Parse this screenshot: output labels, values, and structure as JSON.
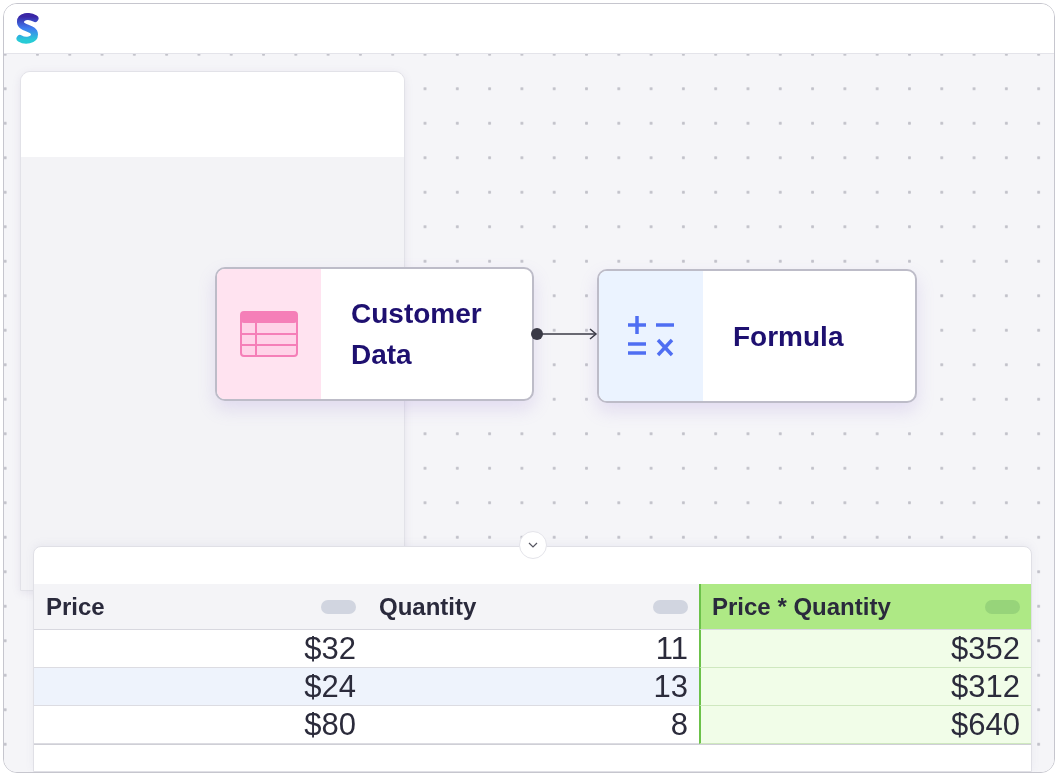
{
  "nodes": [
    {
      "kind": "table",
      "label": "Customer Data"
    },
    {
      "kind": "formula",
      "label": "Formula"
    }
  ],
  "table": {
    "columns": [
      {
        "label": "Price",
        "kind": "data"
      },
      {
        "label": "Quantity",
        "kind": "data"
      },
      {
        "label": "Price * Quantity",
        "kind": "formula"
      }
    ],
    "rows": [
      {
        "selected": false,
        "cells": [
          "$32",
          "11",
          "$352"
        ]
      },
      {
        "selected": true,
        "cells": [
          "$24",
          "13",
          "$312"
        ]
      },
      {
        "selected": false,
        "cells": [
          "$80",
          "8",
          "$640"
        ]
      }
    ]
  }
}
